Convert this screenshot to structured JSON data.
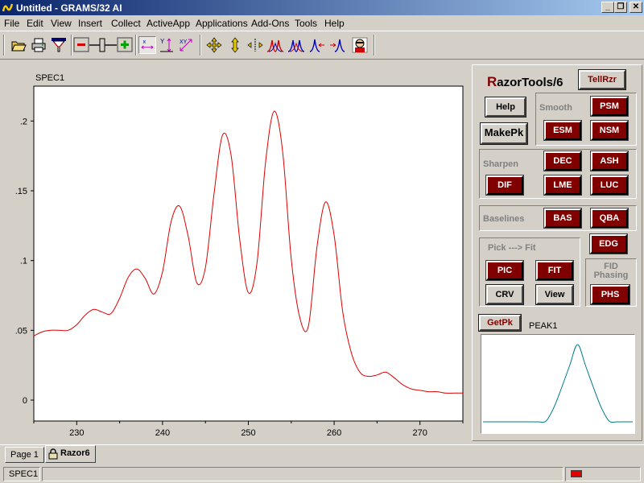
{
  "window": {
    "title": "Untitled - GRAMS/32 AI",
    "minimize_label": "_",
    "restore_label": "❐",
    "close_label": "✕"
  },
  "menu": [
    "File",
    "Edit",
    "View",
    "Insert",
    "Collect",
    "ActiveApp",
    "Applications",
    "Add-Ons",
    "Tools",
    "Help"
  ],
  "toolbar_icons": [
    "open-folder-icon",
    "print-icon",
    "funnel-icon",
    "zoom-slider",
    "cursor-x-icon",
    "expand-y-icon",
    "expand-xy-icon",
    "move-icon",
    "vertical-arrow-icon",
    "horizontal-arrows-icon",
    "peaks-icon",
    "peaks-merge-icon",
    "peak-left-icon",
    "peak-right-icon",
    "user-icon"
  ],
  "spectrum": {
    "name": "SPEC1",
    "line_color": "#dd0000"
  },
  "chart_data": [
    {
      "type": "line",
      "title": "SPEC1",
      "xlabel": "",
      "ylabel": "",
      "xlim": [
        225,
        275
      ],
      "ylim": [
        -0.015,
        0.225
      ],
      "x_ticks": [
        230,
        240,
        250,
        260,
        270
      ],
      "x_tick_labels": [
        "230",
        "240",
        "250",
        "260",
        "270"
      ],
      "y_ticks": [
        0,
        0.05,
        0.1,
        0.15,
        0.2
      ],
      "y_tick_labels": [
        "0",
        ".05",
        ".1",
        ".15",
        ".2"
      ],
      "grid": false,
      "series": [
        {
          "color": "#dd0000",
          "x": [
            225,
            226,
            227,
            228,
            229,
            230,
            231,
            232,
            233,
            234,
            235,
            236,
            237,
            238,
            239,
            240,
            241,
            242,
            243,
            244,
            245,
            246,
            247,
            248,
            249,
            250,
            251,
            252,
            253,
            254,
            255,
            256,
            257,
            258,
            259,
            260,
            261,
            262,
            263,
            264,
            265,
            266,
            267,
            268,
            269,
            270,
            271,
            272,
            273,
            274,
            275
          ],
          "y": [
            0.046,
            0.049,
            0.05,
            0.05,
            0.05,
            0.054,
            0.061,
            0.065,
            0.063,
            0.062,
            0.073,
            0.088,
            0.094,
            0.087,
            0.076,
            0.092,
            0.128,
            0.139,
            0.117,
            0.084,
            0.095,
            0.148,
            0.19,
            0.175,
            0.115,
            0.077,
            0.098,
            0.17,
            0.207,
            0.178,
            0.101,
            0.059,
            0.053,
            0.11,
            0.142,
            0.118,
            0.063,
            0.034,
            0.02,
            0.017,
            0.018,
            0.02,
            0.016,
            0.011,
            0.008,
            0.007,
            0.006,
            0.006,
            0.005,
            0.005,
            0.005
          ]
        }
      ]
    },
    {
      "type": "line",
      "title": "PEAK1",
      "xlabel": "",
      "ylabel": "",
      "grid": false,
      "series": [
        {
          "color": "#007a8a",
          "x": [
            0,
            10,
            20,
            30,
            40,
            50,
            60,
            70,
            80,
            90,
            100,
            110,
            120,
            130,
            140,
            150,
            160,
            170,
            180,
            190
          ],
          "y": [
            0.02,
            0.02,
            0.02,
            0.02,
            0.02,
            0.02,
            0.02,
            0.02,
            0.03,
            0.2,
            0.45,
            0.72,
            0.98,
            0.72,
            0.45,
            0.2,
            0.03,
            0.02,
            0.02,
            0.02
          ]
        }
      ]
    }
  ],
  "razor": {
    "title_r": "R",
    "title_rest": "azorTools/6",
    "tellrzr": "TellRzr",
    "help": "Help",
    "makepk": "MakePk",
    "smooth_label": "Smooth",
    "psm": "PSM",
    "esm": "ESM",
    "nsm": "NSM",
    "sharpen_label": "Sharpen",
    "dec": "DEC",
    "ash": "ASH",
    "dif": "DIF",
    "lme": "LME",
    "luc": "LUC",
    "baselines_label": "Baselines",
    "bas": "BAS",
    "qba": "QBA",
    "edg": "EDG",
    "pickfit_label": "Pick ---> Fit",
    "pic": "PIC",
    "fit": "FIT",
    "crv": "CRV",
    "view": "View",
    "fid_label_1": "FID",
    "fid_label_2": "Phasing",
    "phs": "PHS",
    "getpk": "GetPk",
    "peak_name": "PEAK1",
    "peak_color": "#007a8a"
  },
  "tabs": [
    "Page 1",
    "Razor6"
  ],
  "status": {
    "cell1": "SPEC1",
    "cell2": "",
    "indicator_color": "#e00000"
  }
}
